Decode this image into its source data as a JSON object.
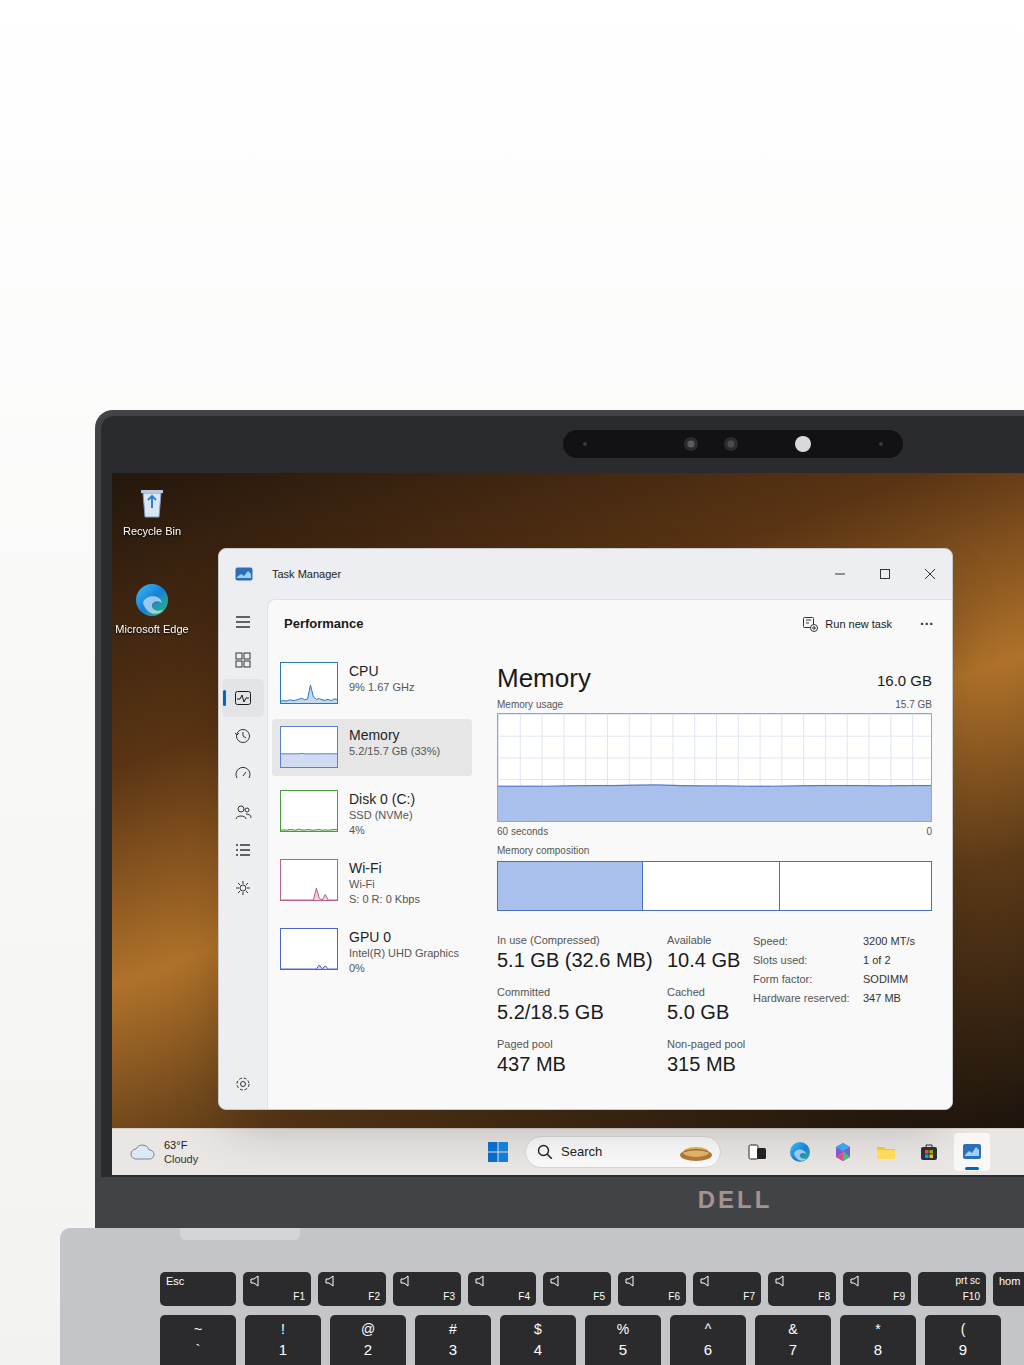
{
  "photo": {
    "logo": "DELL"
  },
  "desktop": {
    "icons": [
      {
        "label": "Recycle Bin",
        "kind": "bin"
      },
      {
        "label": "Microsoft Edge",
        "kind": "edge"
      }
    ]
  },
  "window": {
    "title": "Task Manager"
  },
  "nav": [
    {
      "kind": "menu",
      "selected": false
    },
    {
      "kind": "processes",
      "selected": false
    },
    {
      "kind": "performance",
      "selected": true
    },
    {
      "kind": "history",
      "selected": false
    },
    {
      "kind": "startup",
      "selected": false
    },
    {
      "kind": "users",
      "selected": false
    },
    {
      "kind": "details",
      "selected": false
    },
    {
      "kind": "services",
      "selected": false
    },
    {
      "kind": "settings",
      "selected": false
    }
  ],
  "header": {
    "title": "Performance",
    "action": "Run new task",
    "more": "···"
  },
  "sidebar": [
    {
      "name": "CPU",
      "lines": [
        "9% 1.67 GHz"
      ],
      "selected": false,
      "color": "#2a78c0",
      "values": [
        5,
        6,
        5,
        8,
        6,
        7,
        9,
        12,
        8,
        10,
        45,
        15,
        9,
        11,
        8,
        7,
        9,
        6,
        10,
        9
      ]
    },
    {
      "name": "Memory",
      "lines": [
        "5.2/15.7 GB (33%)"
      ],
      "selected": true,
      "color": "#5a7fd0",
      "values": [
        33,
        33,
        33,
        33,
        33,
        33,
        33,
        34,
        33,
        33,
        33,
        33,
        33,
        33,
        33,
        33,
        33,
        33,
        33,
        33
      ]
    },
    {
      "name": "Disk 0 (C:)",
      "lines": [
        "SSD (NVMe)",
        "4%"
      ],
      "selected": false,
      "color": "#4a9a3c",
      "values": [
        2,
        3,
        2,
        4,
        3,
        2,
        5,
        3,
        2,
        4,
        3,
        2,
        3,
        4,
        2,
        3,
        2,
        3,
        4,
        4
      ]
    },
    {
      "name": "Wi-Fi",
      "lines": [
        "Wi-Fi",
        "S: 0 R: 0 Kbps"
      ],
      "selected": false,
      "color": "#b8608e",
      "values": [
        0,
        0,
        0,
        0,
        0,
        0,
        0,
        0,
        0,
        0,
        0,
        0,
        30,
        4,
        0,
        14,
        0,
        0,
        0,
        0
      ]
    },
    {
      "name": "GPU 0",
      "lines": [
        "Intel(R) UHD Graphics",
        "0%"
      ],
      "selected": false,
      "color": "#4c64cc",
      "values": [
        0,
        0,
        0,
        0,
        0,
        0,
        0,
        0,
        0,
        0,
        0,
        0,
        0,
        10,
        0,
        8,
        0,
        0,
        0,
        0
      ]
    }
  ],
  "detail": {
    "title": "Memory",
    "total": "16.0 GB",
    "usage_label": "Memory usage",
    "max_label": "15.7 GB",
    "usage_max": 15.7,
    "usage_values": [
      5.1,
      5.1,
      5.1,
      5.15,
      5.2,
      5.2,
      5.25,
      5.3,
      5.2,
      5.15,
      5.15,
      5.1,
      5.1,
      5.15,
      5.2,
      5.2,
      5.2,
      5.15,
      5.2,
      5.2
    ],
    "time_label": "60 seconds",
    "zero_label": "0",
    "composition_label": "Memory composition",
    "composition": [
      {
        "level": 0.333,
        "filled": true
      },
      {
        "level": 0.317,
        "filled": false
      },
      {
        "level": 0.35,
        "filled": false
      }
    ],
    "stats": [
      [
        {
          "label": "In use (Compressed)",
          "value": "5.1 GB (32.6 MB)"
        },
        {
          "label": "Available",
          "value": "10.4 GB"
        }
      ],
      [
        {
          "label": "Committed",
          "value": "5.2/18.5 GB"
        },
        {
          "label": "Cached",
          "value": "5.0 GB"
        }
      ],
      [
        {
          "label": "Paged pool",
          "value": "437 MB"
        },
        {
          "label": "Non-paged pool",
          "value": "315 MB"
        }
      ]
    ],
    "specs": [
      {
        "label": "Speed:",
        "value": "3200 MT/s"
      },
      {
        "label": "Slots used:",
        "value": "1 of 2"
      },
      {
        "label": "Form factor:",
        "value": "SODIMM"
      },
      {
        "label": "Hardware reserved:",
        "value": "347 MB"
      }
    ]
  },
  "taskbar": {
    "temp": "63°F",
    "condition": "Cloudy",
    "search": "Search",
    "apps": [
      {
        "kind": "taskview",
        "active": false
      },
      {
        "kind": "edge",
        "active": false
      },
      {
        "kind": "m365",
        "active": false
      },
      {
        "kind": "explorer",
        "active": false
      },
      {
        "kind": "store",
        "active": false
      },
      {
        "kind": "taskmanager",
        "active": true
      }
    ]
  },
  "keyboard": {
    "function_row": [
      {
        "label": "Esc",
        "kind": "main"
      },
      {
        "label": "F1",
        "kind": "fn"
      },
      {
        "label": "F2",
        "kind": "fn"
      },
      {
        "label": "F3",
        "kind": "fn"
      },
      {
        "label": "F4",
        "kind": "fn"
      },
      {
        "label": "F5",
        "kind": "fn"
      },
      {
        "label": "F6",
        "kind": "fn"
      },
      {
        "label": "F7",
        "kind": "fn"
      },
      {
        "label": "F8",
        "kind": "fn"
      },
      {
        "label": "F9",
        "kind": "fn"
      },
      {
        "label": "prt sc",
        "fn": "F10",
        "kind": "fntext"
      },
      {
        "label": "hom",
        "kind": "main"
      }
    ],
    "number_row": [
      {
        "shift": "~",
        "base": "`"
      },
      {
        "shift": "!",
        "base": "1"
      },
      {
        "shift": "@",
        "base": "2"
      },
      {
        "shift": "#",
        "base": "3"
      },
      {
        "shift": "$",
        "base": "4"
      },
      {
        "shift": "%",
        "base": "5"
      },
      {
        "shift": "^",
        "base": "6"
      },
      {
        "shift": "&",
        "base": "7"
      },
      {
        "shift": "*",
        "base": "8"
      },
      {
        "shift": "(",
        "base": "9"
      }
    ]
  }
}
